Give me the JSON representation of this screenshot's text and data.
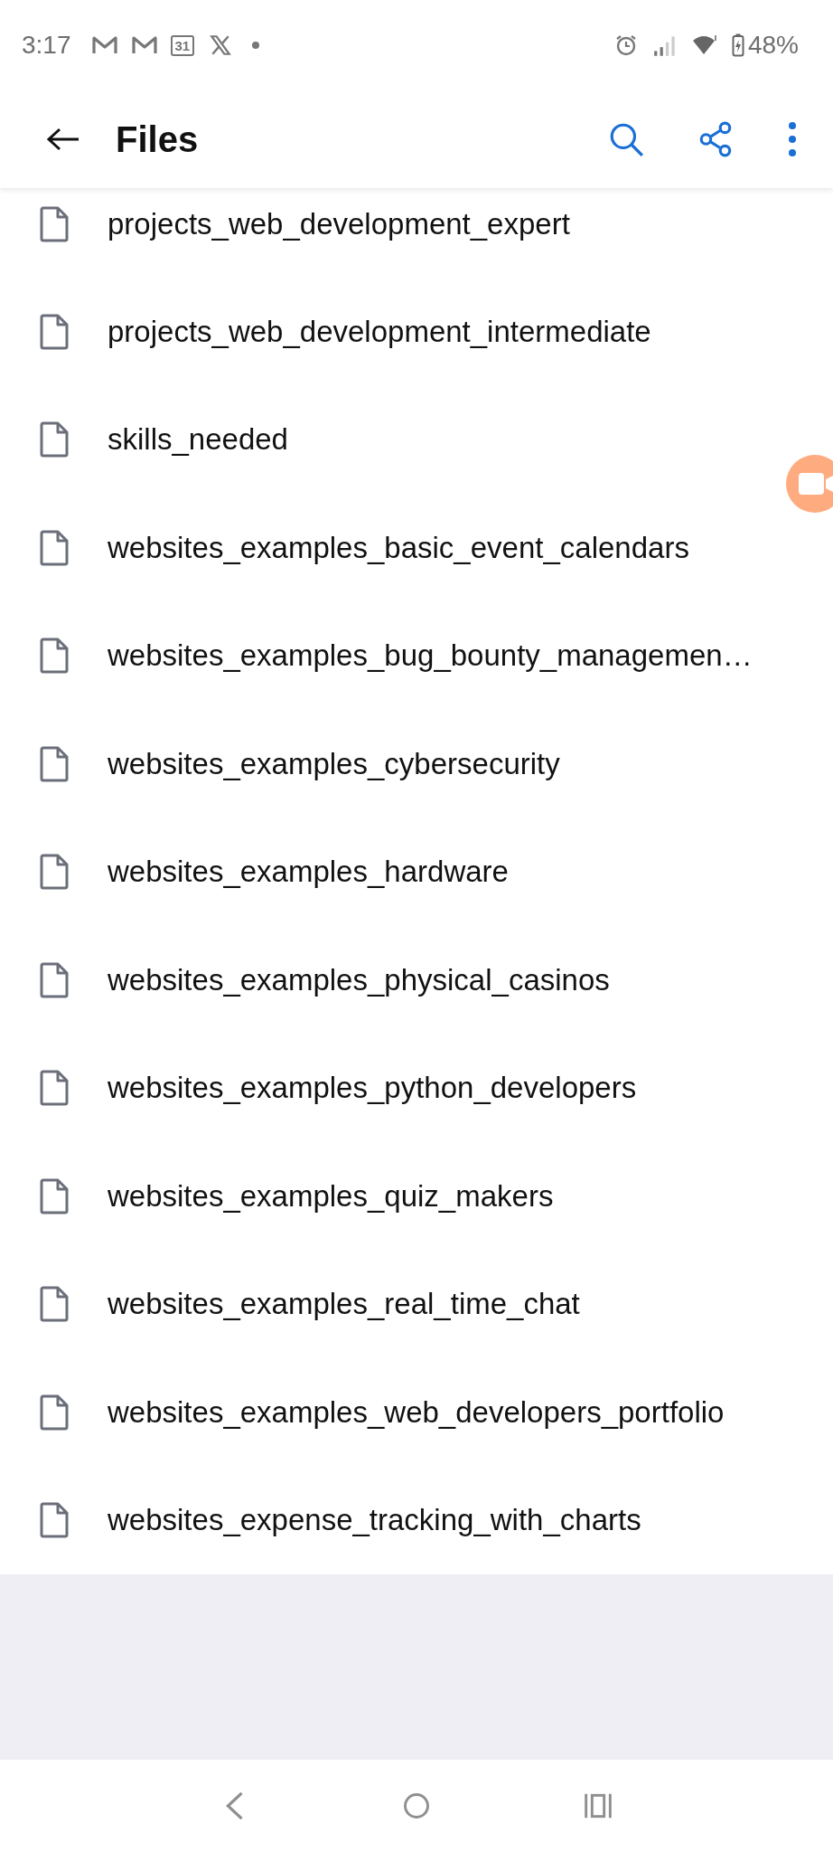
{
  "status_bar": {
    "time": "3:17",
    "calendar_day": "31",
    "battery": "48%"
  },
  "app_bar": {
    "title": "Files"
  },
  "files": [
    {
      "name": "projects_web_development_expert"
    },
    {
      "name": "projects_web_development_intermediate"
    },
    {
      "name": "skills_needed"
    },
    {
      "name": "websites_examples_basic_event_calendars"
    },
    {
      "name": "websites_examples_bug_bounty_managemen…"
    },
    {
      "name": "websites_examples_cybersecurity"
    },
    {
      "name": "websites_examples_hardware"
    },
    {
      "name": "websites_examples_physical_casinos"
    },
    {
      "name": "websites_examples_python_developers"
    },
    {
      "name": "websites_examples_quiz_makers"
    },
    {
      "name": "websites_examples_real_time_chat"
    },
    {
      "name": "websites_examples_web_developers_portfolio"
    },
    {
      "name": "websites_expense_tracking_with_charts"
    }
  ]
}
